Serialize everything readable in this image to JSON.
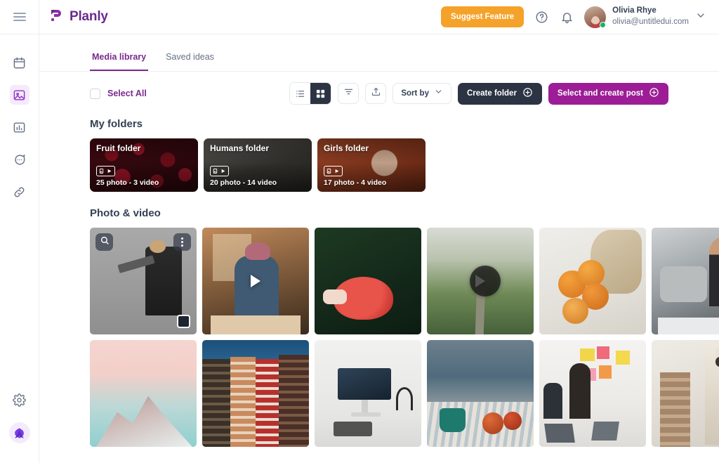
{
  "brand": {
    "name": "Planly",
    "logo_icon": "planly-logo-icon"
  },
  "sidebar": {
    "menu_icon": "hamburger-menu-icon",
    "items": [
      {
        "name": "calendar",
        "icon": "calendar-icon",
        "active": false
      },
      {
        "name": "media",
        "icon": "image-icon",
        "active": true
      },
      {
        "name": "analytics",
        "icon": "bar-chart-icon",
        "active": false
      },
      {
        "name": "messages",
        "icon": "chat-bubble-icon",
        "active": false
      },
      {
        "name": "links",
        "icon": "link-icon",
        "active": false
      }
    ],
    "bottom": [
      {
        "name": "settings",
        "icon": "gear-icon"
      },
      {
        "name": "brand-badge",
        "icon": "planly-leaf-icon"
      }
    ]
  },
  "header": {
    "suggest_feature_label": "Suggest Feature",
    "help_icon": "question-circle-icon",
    "notification_icon": "bell-icon",
    "user": {
      "name": "Olivia Rhye",
      "email": "olivia@untitledui.com",
      "avatar_icon": "user-avatar",
      "status": "online",
      "chevron_icon": "chevron-down-icon"
    }
  },
  "tabs": [
    {
      "label": "Media library",
      "active": true
    },
    {
      "label": "Saved ideas",
      "active": false
    }
  ],
  "toolbar": {
    "select_all_label": "Select All",
    "select_all_checked": false,
    "view_list_icon": "list-view-icon",
    "view_grid_icon": "grid-view-icon",
    "active_view": "grid",
    "filter_icon": "filter-icon",
    "upload_icon": "upload-icon",
    "sort_label": "Sort by",
    "sort_chevron_icon": "chevron-down-icon",
    "create_folder_label": "Create folder",
    "create_folder_icon": "plus-circle-icon",
    "select_create_post_label": "Select and create post",
    "select_create_post_icon": "plus-circle-icon"
  },
  "sections": {
    "folders_title": "My folders",
    "media_title": "Photo & video"
  },
  "folders": [
    {
      "name": "Fruit folder",
      "meta": "25 photo - 3 video",
      "badge_icon": "photo-video-icon"
    },
    {
      "name": "Humans folder",
      "meta": "20 photo - 14 video",
      "badge_icon": "photo-video-icon"
    },
    {
      "name": "Girls folder",
      "meta": "17 photo - 4 video",
      "badge_icon": "photo-video-icon"
    }
  ],
  "media": [
    {
      "alt": "person hanging art on wall",
      "type": "photo",
      "hovered": true,
      "selected": true,
      "search_icon": "magnifier-icon",
      "menu_icon": "more-vertical-icon"
    },
    {
      "alt": "man peeling food at table",
      "type": "video"
    },
    {
      "alt": "hand holding red coffee cup",
      "type": "photo"
    },
    {
      "alt": "aerial road through green fields",
      "type": "video"
    },
    {
      "alt": "apricots spilling from cloth bag",
      "type": "photo"
    },
    {
      "alt": "woman podcasting with microphone",
      "type": "photo"
    },
    {
      "alt": "pink sky over snowy mountain",
      "type": "photo"
    },
    {
      "alt": "amsterdam row houses facade",
      "type": "photo"
    },
    {
      "alt": "desk setup with monitor and headphones",
      "type": "photo"
    },
    {
      "alt": "mug and apples on beach blanket",
      "type": "photo"
    },
    {
      "alt": "team workshop with sticky notes",
      "type": "photo"
    },
    {
      "alt": "old stone bell tower",
      "type": "photo"
    }
  ],
  "colors": {
    "brand_purple": "#7a2a8d",
    "accent_orange": "#f5a22b",
    "dark_navy": "#2c3444",
    "magenta": "#9c1d96",
    "online_green": "#17b26a"
  }
}
